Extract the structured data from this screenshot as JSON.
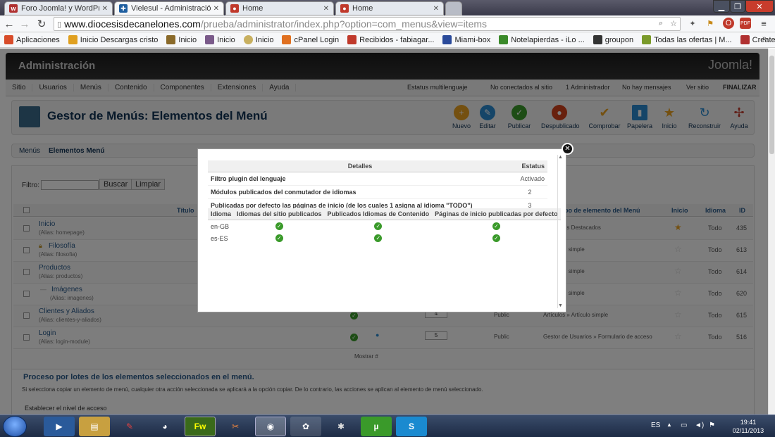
{
  "browser": {
    "tabs": [
      {
        "label": "Foro Joomla! y WordPress",
        "active": false,
        "color": "#b03030"
      },
      {
        "label": "Vielesul - Administración",
        "active": true,
        "color": "#1f5fa0"
      },
      {
        "label": "Home",
        "active": false,
        "color": "#c0392b"
      },
      {
        "label": "Home",
        "active": false,
        "color": "#c0392b"
      }
    ],
    "url_host": "www.diocesisdecanelones.com",
    "url_path": "/prueba/administrator/index.php?option=com_menus&view=items",
    "bookmarks": [
      {
        "label": "Aplicaciones",
        "color": "#d84c2a"
      },
      {
        "label": "Inicio Descargas cristo",
        "color": "#e0a020"
      },
      {
        "label": "Inicio",
        "color": "#8a6a2a"
      },
      {
        "label": "Inicio",
        "color": "#7a5a8a"
      },
      {
        "label": "Inicio",
        "color": "#c8b060"
      },
      {
        "label": "cPanel Login",
        "color": "#e07020"
      },
      {
        "label": "Recibidos - fabiagar...",
        "color": "#c0392b"
      },
      {
        "label": "Miami-box",
        "color": "#2a4a9a"
      },
      {
        "label": "Notelapierdas - iLo ...",
        "color": "#3a8a2a"
      },
      {
        "label": "groupon",
        "color": "#333333"
      },
      {
        "label": "Todas las ofertas | M...",
        "color": "#7a9a2a"
      },
      {
        "label": "Created by Camtasi...",
        "color": "#b03030"
      }
    ]
  },
  "admin": {
    "title": "Administración",
    "logo": "Joomla!",
    "menu": [
      "Sitio",
      "Usuarios",
      "Menús",
      "Contenido",
      "Componentes",
      "Extensiones",
      "Ayuda"
    ],
    "status": [
      "Estatus multilenguaje",
      "No conectados al sitio",
      "1 Administrador",
      "No hay mensajes",
      "Ver sitio",
      "FINALIZAR"
    ],
    "page_title": "Gestor de Menús: Elementos del Menú",
    "toolbar": [
      {
        "label": "Nuevo",
        "color": "#e8a020",
        "icon": "plus-icon"
      },
      {
        "label": "Editar",
        "color": "#2a8ad0",
        "icon": "edit-icon"
      },
      {
        "label": "Publicar",
        "color": "#3a9a2a",
        "icon": "check-icon"
      },
      {
        "label": "Despublicado",
        "color": "#d0401a",
        "icon": "unpublish-icon"
      },
      {
        "label": "Comprobar",
        "color": "#e8a020",
        "icon": "checkin-icon"
      },
      {
        "label": "Papelera",
        "color": "#2a8ad0",
        "icon": "trash-icon"
      },
      {
        "label": "Inicio",
        "color": "#e8a020",
        "icon": "star-icon"
      },
      {
        "label": "Reconstruir",
        "color": "#2a8ad0",
        "icon": "refresh-icon"
      },
      {
        "label": "Ayuda",
        "color": "#c0392b",
        "icon": "help-icon"
      }
    ],
    "subnav": [
      "Menús",
      "Elementos Menú"
    ],
    "filter_label": "Filtro:",
    "search_button": "Buscar",
    "clear_button": "Limpiar",
    "columns": [
      "Título",
      "po de elemento del Menú",
      "Inicio",
      "Idioma",
      "ID"
    ],
    "rows": [
      {
        "name": "Inicio",
        "alias": "(Alias: homepage)",
        "tipo": "» Artículos Destacados",
        "home": true,
        "lang": "Todo",
        "id": "435"
      },
      {
        "name": "Filosofía",
        "alias": "(Alias: filosofia)",
        "tipo": "» Artículo simple",
        "home": false,
        "lang": "Todo",
        "id": "613"
      },
      {
        "name": "Productos",
        "alias": "(Alias: productos)",
        "tipo": "» Artículo simple",
        "home": false,
        "lang": "Todo",
        "id": "614"
      },
      {
        "name": "Imágenes",
        "alias": "(Alias: imagenes)",
        "tipo": "» Artículo simple",
        "home": false,
        "lang": "Todo",
        "id": "620"
      },
      {
        "name": "Clientes y Aliados",
        "alias": "(Alias: clientes-y-aliados)",
        "tipo": "Artículos » Artículo simple",
        "home": false,
        "lang": "Todo",
        "id": "615"
      },
      {
        "name": "Login",
        "alias": "(Alias: login-module)",
        "tipo": "Gestor de Usuarios » Formulario de acceso",
        "home": false,
        "lang": "Todo",
        "id": "516"
      }
    ],
    "login_order": "5",
    "login_access": "Public",
    "clientes_order": "4",
    "clientes_access": "Public",
    "show": "Mostrar #",
    "batch_title": "Proceso por lotes de los elementos seleccionados en el menú.",
    "batch_desc": "Si selecciona copiar un elemento de menú, cualquier otra acción seleccionada se aplicará a la opción copiar. De lo contrario, las acciones se aplican al elemento de menú seleccionado.",
    "batch_access": "Establecer el nivel de acceso"
  },
  "modal": {
    "head_details": "Detalles",
    "head_status": "Estatus",
    "details": [
      {
        "label": "Filtro plugin del lenguaje",
        "value": "Activado"
      },
      {
        "label": "Módulos publicados del conmutador de idiomas",
        "value": "2"
      },
      {
        "label": "Publicadas por defecto las páginas de inicio (de los cuales 1 asigna al idioma \"TODO\")",
        "value": "3"
      }
    ],
    "lang_headers": [
      "Idioma",
      "Idiomas del sitio publicados",
      "Publicados Idiomas de Contenido",
      "Páginas de inicio publicadas por defecto"
    ],
    "langs": [
      "en-GB",
      "es-ES"
    ]
  },
  "taskbar": {
    "lang": "ES",
    "time": "19:41",
    "date": "02/11/2013"
  }
}
